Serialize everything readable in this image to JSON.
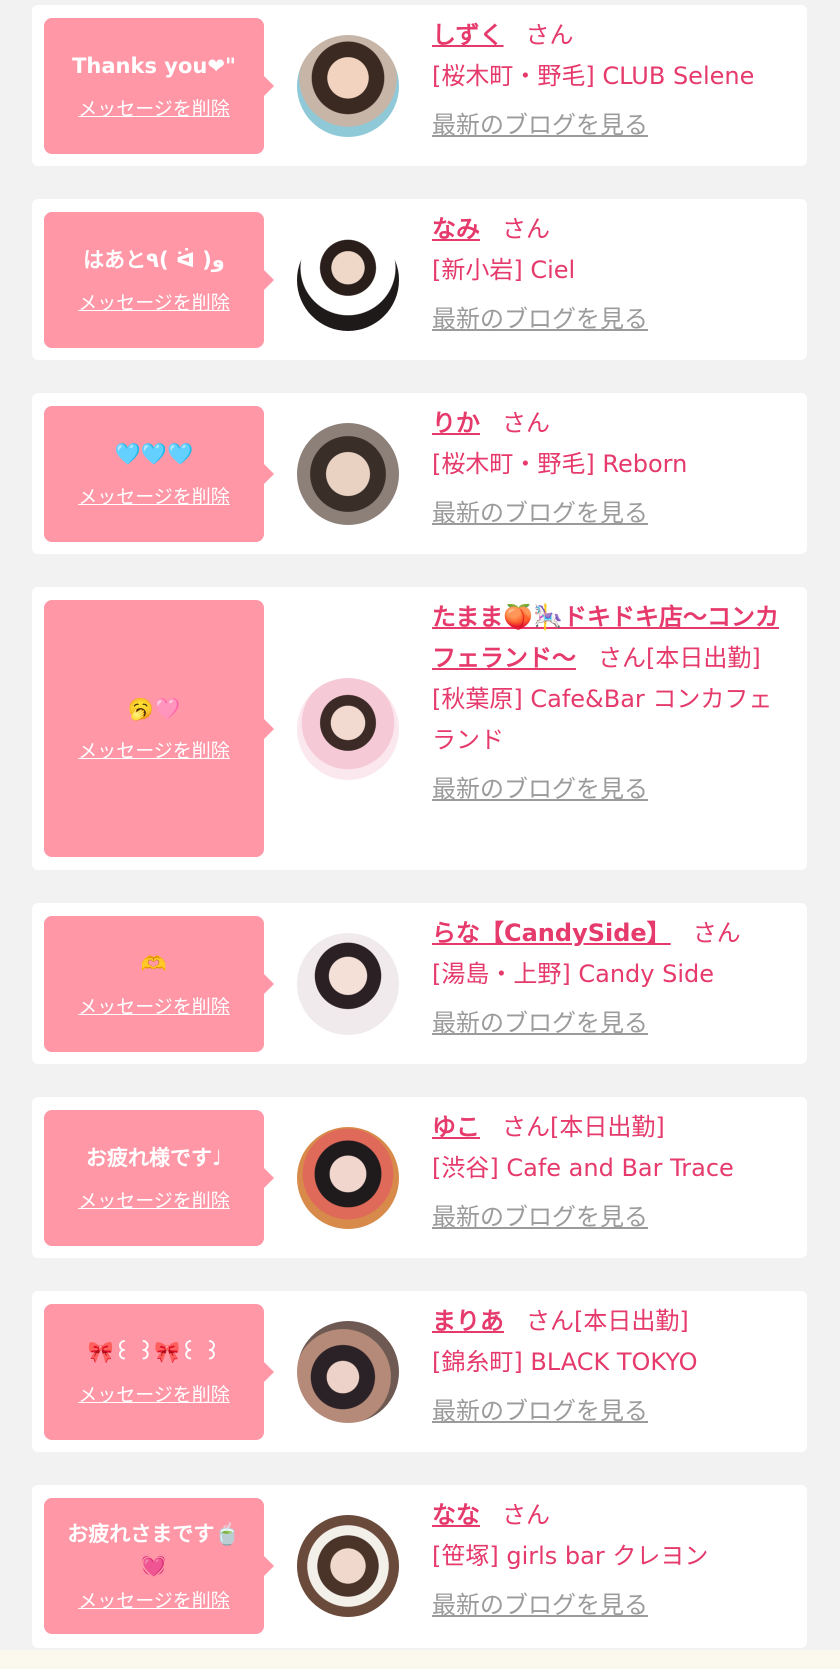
{
  "common": {
    "delete_label": "メッセージを削除",
    "blog_label": "最新のブログを見る",
    "san": "さん"
  },
  "messages": [
    {
      "message": "Thanks you❤\"",
      "name": "しずく",
      "suffix": "さん",
      "shop": "[桜木町・野毛] CLUB Selene",
      "avatar_icon": "woman-portrait-1"
    },
    {
      "message": "はあと٩( ᐛ )و",
      "name": "なみ",
      "suffix": "さん",
      "shop": "[新小岩] Ciel",
      "avatar_icon": "woman-portrait-2"
    },
    {
      "message": "🩵🩵🩵",
      "name": "りか",
      "suffix": "さん",
      "shop": "[桜木町・野毛] Reborn",
      "avatar_icon": "woman-portrait-3"
    },
    {
      "message": "🥱🩷",
      "name": "たまま🍑🎠ドキドキ店〜コンカフェランド〜",
      "suffix": "さん[本日出勤]",
      "shop": "[秋葉原] Cafe&Bar コンカフェランド",
      "avatar_icon": "woman-portrait-4"
    },
    {
      "message": "🫶",
      "name": "らな【CandySide】",
      "suffix": "さん",
      "shop": "[湯島・上野] Candy Side",
      "avatar_icon": "woman-portrait-5"
    },
    {
      "message": "お疲れ様です♩",
      "name": "ゆこ",
      "suffix": "さん[本日出勤]",
      "shop": "[渋谷] Cafe and Bar Trace",
      "avatar_icon": "woman-portrait-6"
    },
    {
      "message": "🎀꒰ ꒱🎀꒰ ꒱",
      "name": "まりあ",
      "suffix": "さん[本日出勤]",
      "shop": "[錦糸町] BLACK TOKYO",
      "avatar_icon": "woman-portrait-7"
    },
    {
      "message": "お疲れさまです🍵\n💓",
      "name": "なな",
      "suffix": "さん",
      "shop": "[笹塚] girls bar クレヨン",
      "avatar_icon": "woman-portrait-8"
    }
  ],
  "colors": {
    "accent": "#e53a6b",
    "bubble": "#ff97a7",
    "muted": "#9b9b9b",
    "background": "#f2f2f2"
  }
}
